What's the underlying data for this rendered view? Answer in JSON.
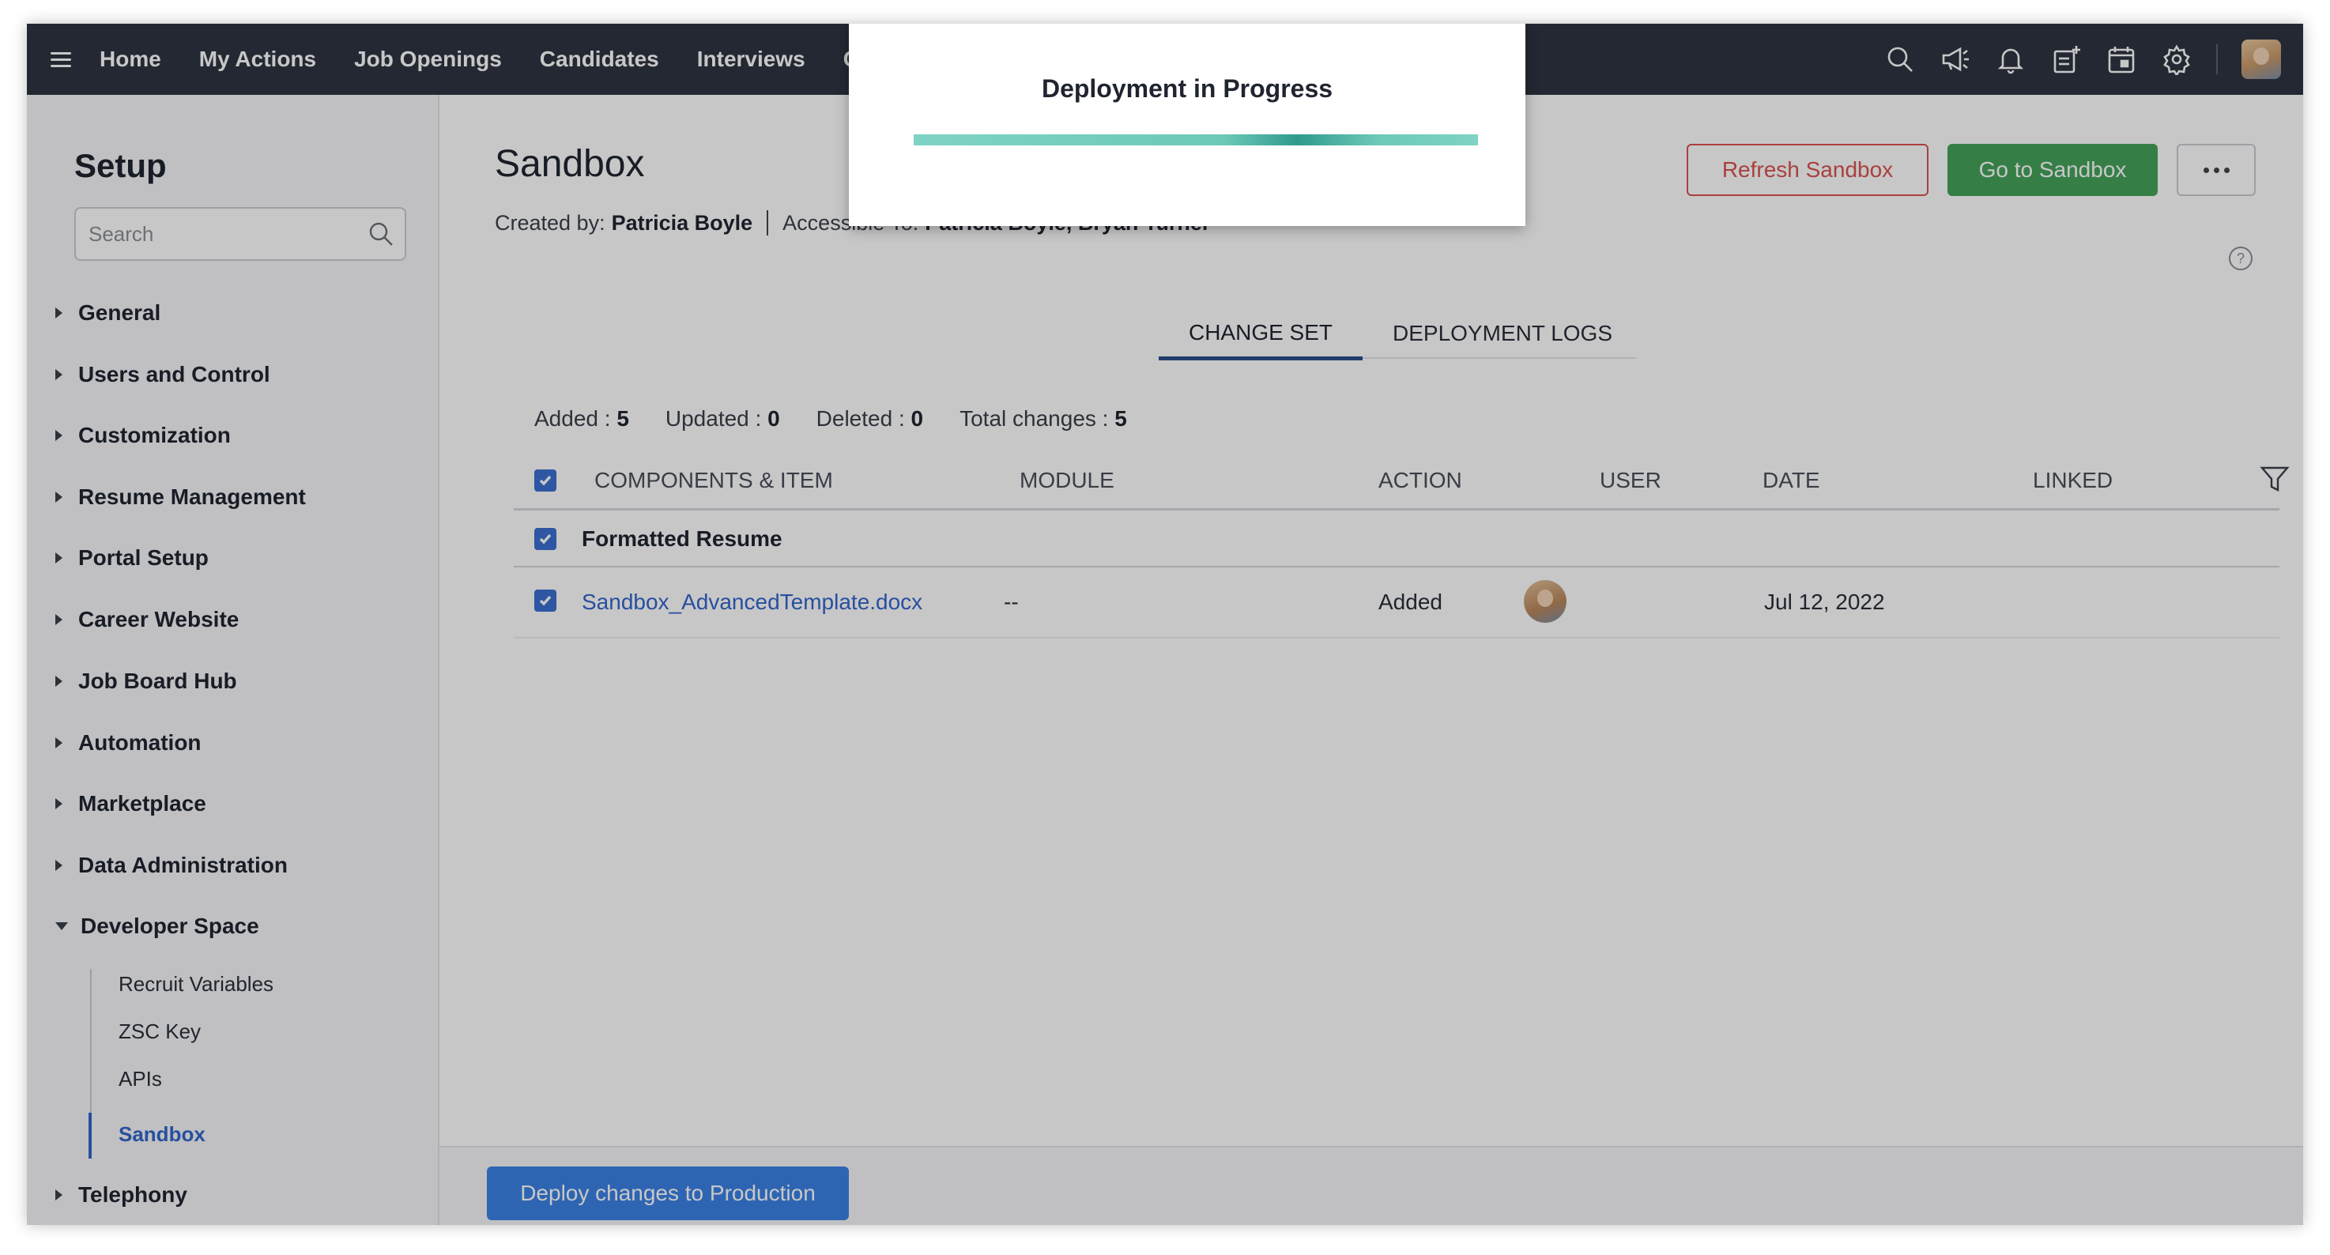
{
  "topnav": {
    "items": [
      "Home",
      "My Actions",
      "Job Openings",
      "Candidates",
      "Interviews",
      "C"
    ],
    "icons": [
      "search-icon",
      "megaphone-icon",
      "bell-icon",
      "add-note-icon",
      "calendar-icon",
      "gear-icon"
    ]
  },
  "sidebar": {
    "title": "Setup",
    "search_placeholder": "Search",
    "items": [
      "General",
      "Users and Control",
      "Customization",
      "Resume Management",
      "Portal Setup",
      "Career Website",
      "Job Board Hub",
      "Automation",
      "Marketplace",
      "Data Administration",
      "Developer Space",
      "Telephony"
    ],
    "expanded": "Developer Space",
    "sub_items": [
      "Recruit Variables",
      "ZSC Key",
      "APIs",
      "Sandbox"
    ],
    "active_sub_item": "Sandbox"
  },
  "main": {
    "title": "Sandbox",
    "created_by_label": "Created by:",
    "created_by": "Patricia Boyle",
    "accessible_label": "Accessible To:",
    "accessible_to": "Patricia Boyle, Bryan Turner",
    "refresh_label": "Refresh Sandbox",
    "go_label": "Go to Sandbox",
    "tabs": [
      "CHANGE SET",
      "DEPLOYMENT LOGS"
    ],
    "active_tab": "CHANGE SET",
    "counts": {
      "added_label": "Added :",
      "added": "5",
      "updated_label": "Updated :",
      "updated": "0",
      "deleted_label": "Deleted :",
      "deleted": "0",
      "total_label": "Total changes :",
      "total": "5"
    },
    "table": {
      "columns": [
        "COMPONENTS & ITEM",
        "MODULE",
        "ACTION",
        "USER",
        "DATE",
        "LINKED"
      ],
      "group": "Formatted Resume",
      "rows": [
        {
          "item": "Sandbox_AdvancedTemplate.docx",
          "module": "--",
          "action": "Added",
          "date": "Jul 12, 2022"
        }
      ]
    },
    "deploy_label": "Deploy changes to Production"
  },
  "modal": {
    "title": "Deployment in Progress",
    "progress": 1.0
  },
  "colors": {
    "nav_bg": "#2e3440",
    "accent_blue": "#3366cc",
    "refresh_red": "#d9534f",
    "go_green": "#45a35c",
    "progress_teal": "#6cc9b8"
  }
}
